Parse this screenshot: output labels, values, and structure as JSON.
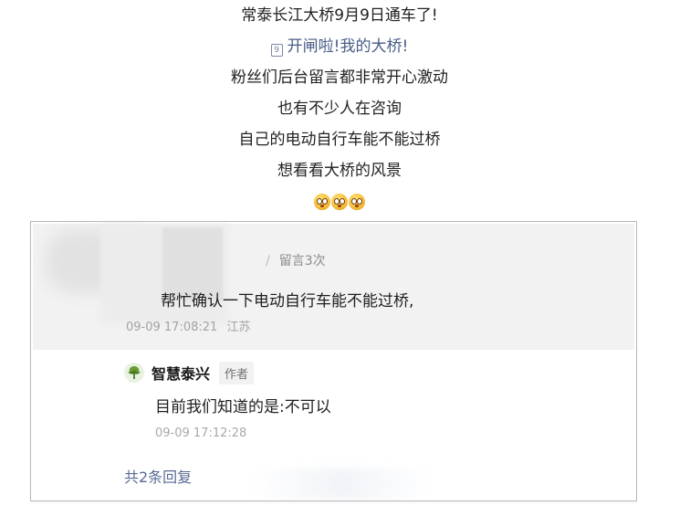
{
  "article": {
    "lines": [
      "常泰长江大桥9月9日通车了!",
      "开闸啦!我的大桥!",
      "粉丝们后台留言都非常开心激动",
      "也有不少人在咨询",
      "自己的电动自行车能不能过桥",
      "想看看大桥的风景"
    ],
    "emoji_icon": "astonished-face-emoji-icon"
  },
  "comment": {
    "reply_count_badge": "留言3次",
    "reader_text": "帮忙确认一下电动自行车能不能过桥,",
    "reader_time": "09-09 17:08:21",
    "reader_location": "江苏",
    "author": {
      "name": "智慧泰兴",
      "badge": "作者",
      "avatar_icon": "tree-logo-icon",
      "reply_text": "目前我们知道的是:不可以",
      "reply_time": "09-09 17:12:28"
    },
    "total_replies_link": "共2条回复"
  },
  "colors": {
    "link": "#576b95",
    "muted": "#a3a3a3",
    "reader_bg": "#f2f2f2",
    "author_logo": "#5a8a2c"
  }
}
